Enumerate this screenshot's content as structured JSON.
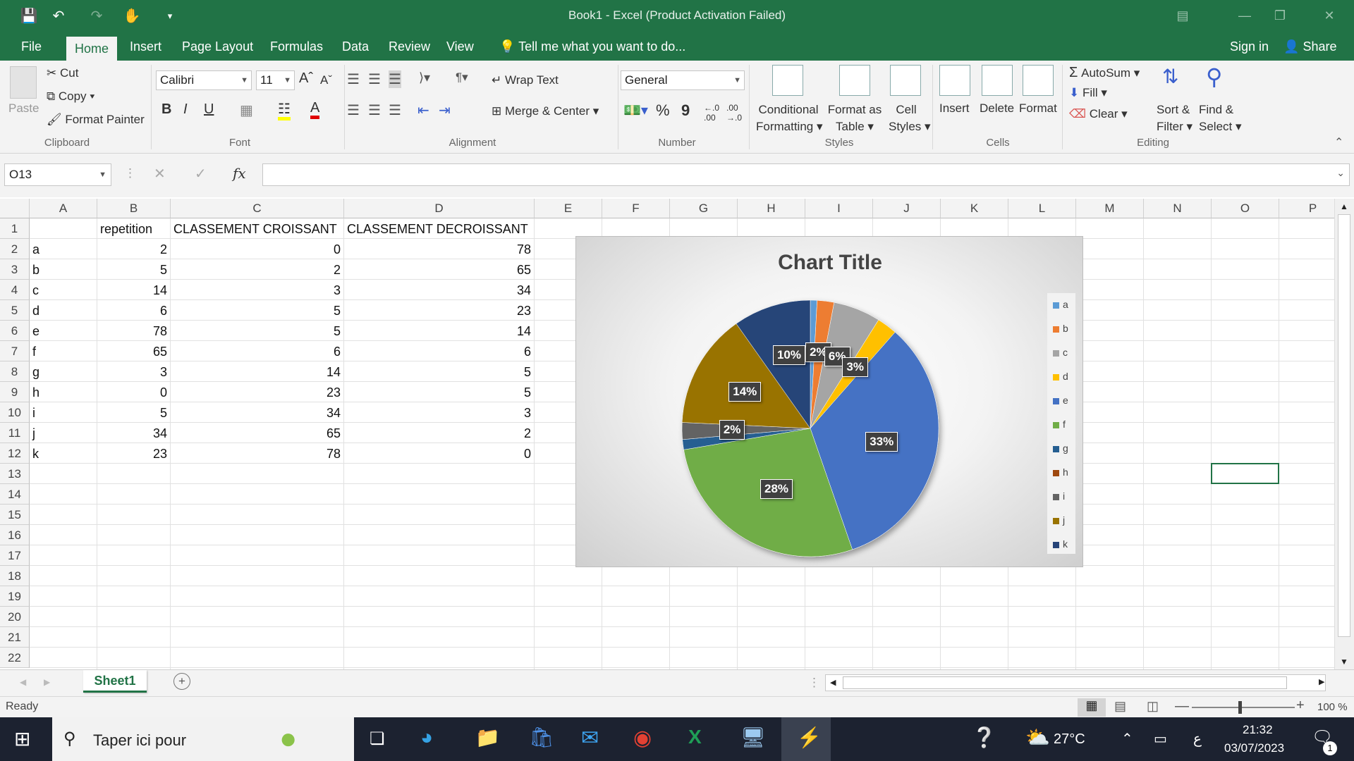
{
  "window": {
    "title": "Book1 - Excel (Product Activation Failed)"
  },
  "menu": {
    "tabs": [
      "File",
      "Home",
      "Insert",
      "Page Layout",
      "Formulas",
      "Data",
      "Review",
      "View"
    ],
    "tell_me": "Tell me what you want to do...",
    "sign_in": "Sign in",
    "share": "Share"
  },
  "ribbon": {
    "clipboard": {
      "paste": "Paste",
      "cut": "Cut",
      "copy": "Copy",
      "format_painter": "Format Painter",
      "label": "Clipboard"
    },
    "font": {
      "name": "Calibri",
      "size": "11",
      "bold": "B",
      "italic": "I",
      "underline": "U",
      "label": "Font"
    },
    "alignment": {
      "wrap": "Wrap Text",
      "merge": "Merge & Center",
      "label": "Alignment"
    },
    "number": {
      "format": "General",
      "percent": "%",
      "comma": "9",
      "label": "Number"
    },
    "styles": {
      "conditional": "Conditional",
      "conditional2": "Formatting",
      "format_as": "Format as",
      "format_as2": "Table",
      "cell": "Cell",
      "cell2": "Styles",
      "label": "Styles"
    },
    "cells": {
      "insert": "Insert",
      "delete": "Delete",
      "format": "Format",
      "label": "Cells"
    },
    "editing": {
      "autosum": "AutoSum",
      "fill": "Fill",
      "clear": "Clear",
      "sort": "Sort &",
      "sort2": "Filter",
      "find": "Find &",
      "find2": "Select",
      "label": "Editing"
    }
  },
  "formula_bar": {
    "name_box": "O13",
    "fx": "fx",
    "value": ""
  },
  "columns": [
    "A",
    "B",
    "C",
    "D",
    "E",
    "F",
    "G",
    "H",
    "I",
    "J",
    "K",
    "L",
    "M",
    "N",
    "O",
    "P"
  ],
  "rows": [
    "1",
    "2",
    "3",
    "4",
    "5",
    "6",
    "7",
    "8",
    "9",
    "10",
    "11",
    "12",
    "13",
    "14",
    "15",
    "16",
    "17",
    "18",
    "19",
    "20",
    "21",
    "22"
  ],
  "table": {
    "headers": [
      "",
      "repetition",
      "CLASSEMENT CROISSANT",
      "CLASSEMENT DECROISSANT"
    ],
    "rows": [
      [
        "a",
        "2",
        "0",
        "78"
      ],
      [
        "b",
        "5",
        "2",
        "65"
      ],
      [
        "c",
        "14",
        "3",
        "34"
      ],
      [
        "d",
        "6",
        "5",
        "23"
      ],
      [
        "e",
        "78",
        "5",
        "14"
      ],
      [
        "f",
        "65",
        "6",
        "6"
      ],
      [
        "g",
        "3",
        "14",
        "5"
      ],
      [
        "h",
        "0",
        "23",
        "5"
      ],
      [
        "i",
        "5",
        "34",
        "3"
      ],
      [
        "j",
        "34",
        "65",
        "2"
      ],
      [
        "k",
        "23",
        "78",
        "0"
      ]
    ]
  },
  "chart_data": {
    "type": "pie",
    "title": "Chart Title",
    "categories": [
      "a",
      "b",
      "c",
      "d",
      "e",
      "f",
      "g",
      "h",
      "i",
      "j",
      "k"
    ],
    "values": [
      2,
      5,
      14,
      6,
      78,
      65,
      3,
      0,
      5,
      34,
      23
    ],
    "colors": [
      "#5b9bd5",
      "#ed7d31",
      "#a5a5a5",
      "#ffc000",
      "#4472c4",
      "#70ad47",
      "#255e91",
      "#9e480e",
      "#636363",
      "#997300",
      "#264478"
    ],
    "data_labels": [
      "",
      "2%",
      "6%",
      "3%",
      "33%",
      "28%",
      "",
      "",
      "2%",
      "14%",
      "10%"
    ],
    "legend": "right"
  },
  "sheet": {
    "tab": "Sheet1",
    "status": "Ready",
    "zoom": "100 %"
  },
  "taskbar": {
    "search": "Taper ici pour",
    "weather": "27°C",
    "lang": "ع",
    "time": "21:32",
    "date": "03/07/2023",
    "notif": "1"
  }
}
